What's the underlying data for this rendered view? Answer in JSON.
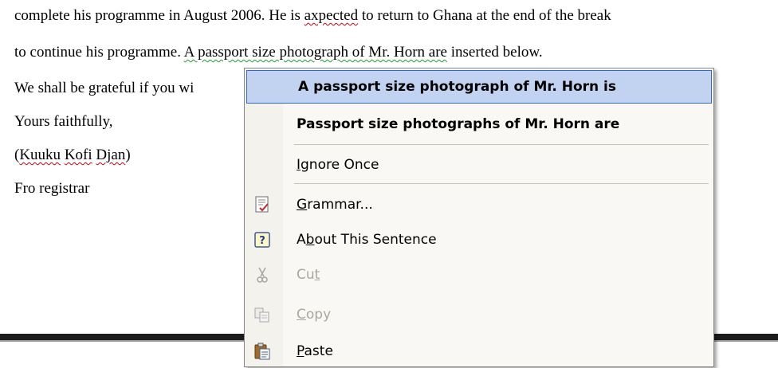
{
  "document": {
    "line1": {
      "pre": "complete his programme in August 2006. He is ",
      "flag": "axpected",
      "post": " to return to Ghana at the end of the break"
    },
    "line2": {
      "pre": "to continue his programme. ",
      "flag": "A passport size photograph of Mr. Horn are",
      "post": " inserted below."
    },
    "line3": "We shall be grateful if you wi",
    "line4": "Yours faithfully,",
    "line5": {
      "open": "(",
      "w1": "Kuuku",
      "sp1": " ",
      "w2": "Kofi",
      "sp2": " ",
      "w3": "Djan",
      "close": ")"
    },
    "line6": "Fro registrar"
  },
  "menu": {
    "suggestion1": "A passport size photograph of Mr. Horn is",
    "suggestion2": "Passport size photographs of Mr. Horn are",
    "ignore": {
      "pre": "",
      "key": "I",
      "post": "gnore Once"
    },
    "grammar": {
      "pre": "",
      "key": "G",
      "post": "rammar..."
    },
    "about": {
      "pre": "A",
      "key": "b",
      "post": "out This Sentence"
    },
    "cut": {
      "pre": "Cu",
      "key": "t",
      "post": ""
    },
    "copy": {
      "pre": "",
      "key": "C",
      "post": "opy"
    },
    "paste": {
      "pre": "",
      "key": "P",
      "post": "aste"
    },
    "icons": {
      "grammar": "grammar-check-icon",
      "about": "help-question-icon",
      "cut": "scissors-icon",
      "copy": "copy-icon",
      "paste": "paste-clipboard-icon"
    },
    "colors": {
      "highlight": "#c1d3f0",
      "highlight_border": "#316ac5",
      "spelling": "#d4000a",
      "grammar": "#1f9b2b"
    }
  }
}
